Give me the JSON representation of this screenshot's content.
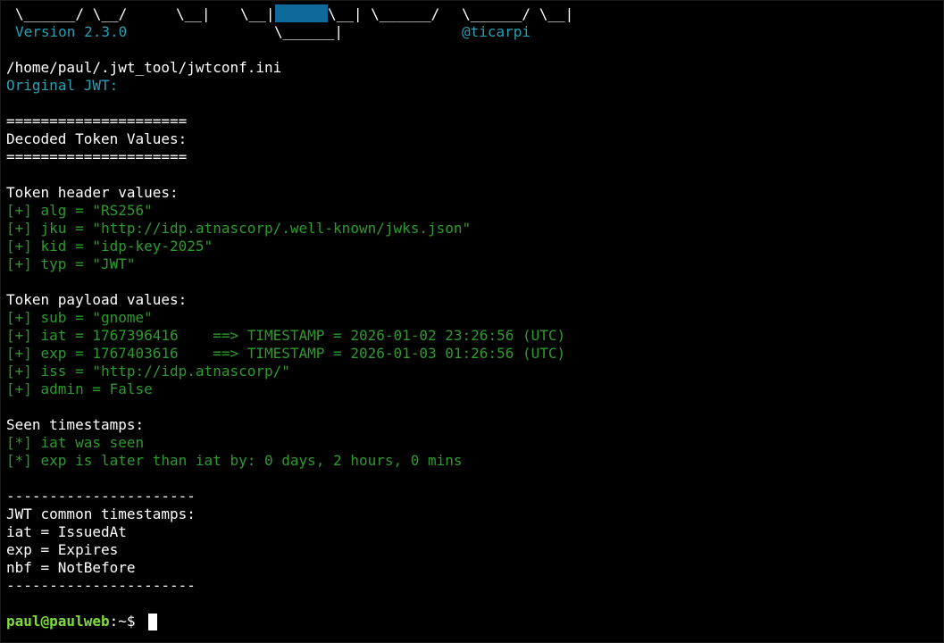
{
  "banner": {
    "art_left": "\\______/ \\__/",
    "art_mid1": "\\__|",
    "art_mid2": "\\__|",
    "art_mid3": "\\__| \\______/",
    "art_right": "\\______/ \\__|",
    "version": "Version 2.3.0",
    "art_bottom": "\\______|",
    "author": "@ticarpi"
  },
  "config_path": "/home/paul/.jwt_tool/jwtconf.ini",
  "original_jwt_label": "Original JWT:",
  "sections": {
    "rule_equals": "=====================",
    "decoded_title": "Decoded Token Values:",
    "header_title": "Token header values:",
    "payload_title": "Token payload values:",
    "seen_title": "Seen timestamps:",
    "rule_dashes": "----------------------",
    "common_title": "JWT common timestamps:"
  },
  "header_values": [
    "[+] alg = \"RS256\"",
    "[+] jku = \"http://idp.atnascorp/.well-known/jwks.json\"",
    "[+] kid = \"idp-key-2025\"",
    "[+] typ = \"JWT\""
  ],
  "payload_values": [
    "[+] sub = \"gnome\"",
    "[+] iat = 1767396416    ==> TIMESTAMP = 2026-01-02 23:26:56 (UTC)",
    "[+] exp = 1767403616    ==> TIMESTAMP = 2026-01-03 01:26:56 (UTC)",
    "[+] iss = \"http://idp.atnascorp/\"",
    "[+] admin = False"
  ],
  "seen_values": [
    "[*] iat was seen",
    "[*] exp is later than iat by: 0 days, 2 hours, 0 mins"
  ],
  "common_values": [
    "iat = IssuedAt",
    "exp = Expires",
    "nbf = NotBefore"
  ],
  "prompt": {
    "user_host": "paul@paulweb",
    "path": ":~$ "
  },
  "colors": {
    "background": "#000000",
    "text": "#ffffff",
    "teal": "#26a0b4",
    "green": "#2e9a2e",
    "prompt": "#7ddc3a",
    "highlight": "#0f6a9c"
  }
}
